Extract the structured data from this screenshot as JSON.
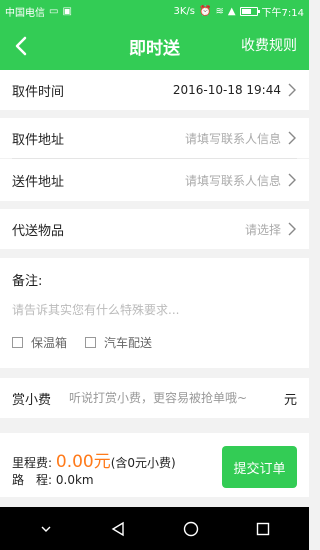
{
  "status_bar": {
    "carrier": "中国电信",
    "speed": "3K/s",
    "time": "下午7:14"
  },
  "header": {
    "title": "即时送",
    "action": "收费规则"
  },
  "form": {
    "pickup_time": {
      "label": "取件时间",
      "value": "2016-10-18 19:44"
    },
    "pickup_address": {
      "label": "取件地址",
      "placeholder": "请填写联系人信息"
    },
    "delivery_address": {
      "label": "送件地址",
      "placeholder": "请填写联系人信息"
    },
    "item": {
      "label": "代送物品",
      "placeholder": "请选择"
    }
  },
  "notes": {
    "title": "备注:",
    "placeholder": "请告诉其实您有什么特殊要求...",
    "options": [
      "保温箱",
      "汽车配送"
    ]
  },
  "tip": {
    "label": "赏小费",
    "placeholder": "听说打赏小费，更容易被抢单哦~",
    "unit": "元"
  },
  "footer": {
    "fee_label": "里程费:",
    "fee_amount": "0.00元",
    "fee_note": "(含0元小费)",
    "distance_label": "路　程:",
    "distance_value": "0.0km",
    "submit": "提交订单"
  },
  "colors": {
    "primary": "#33cc55",
    "accent": "#ff7a1a"
  }
}
